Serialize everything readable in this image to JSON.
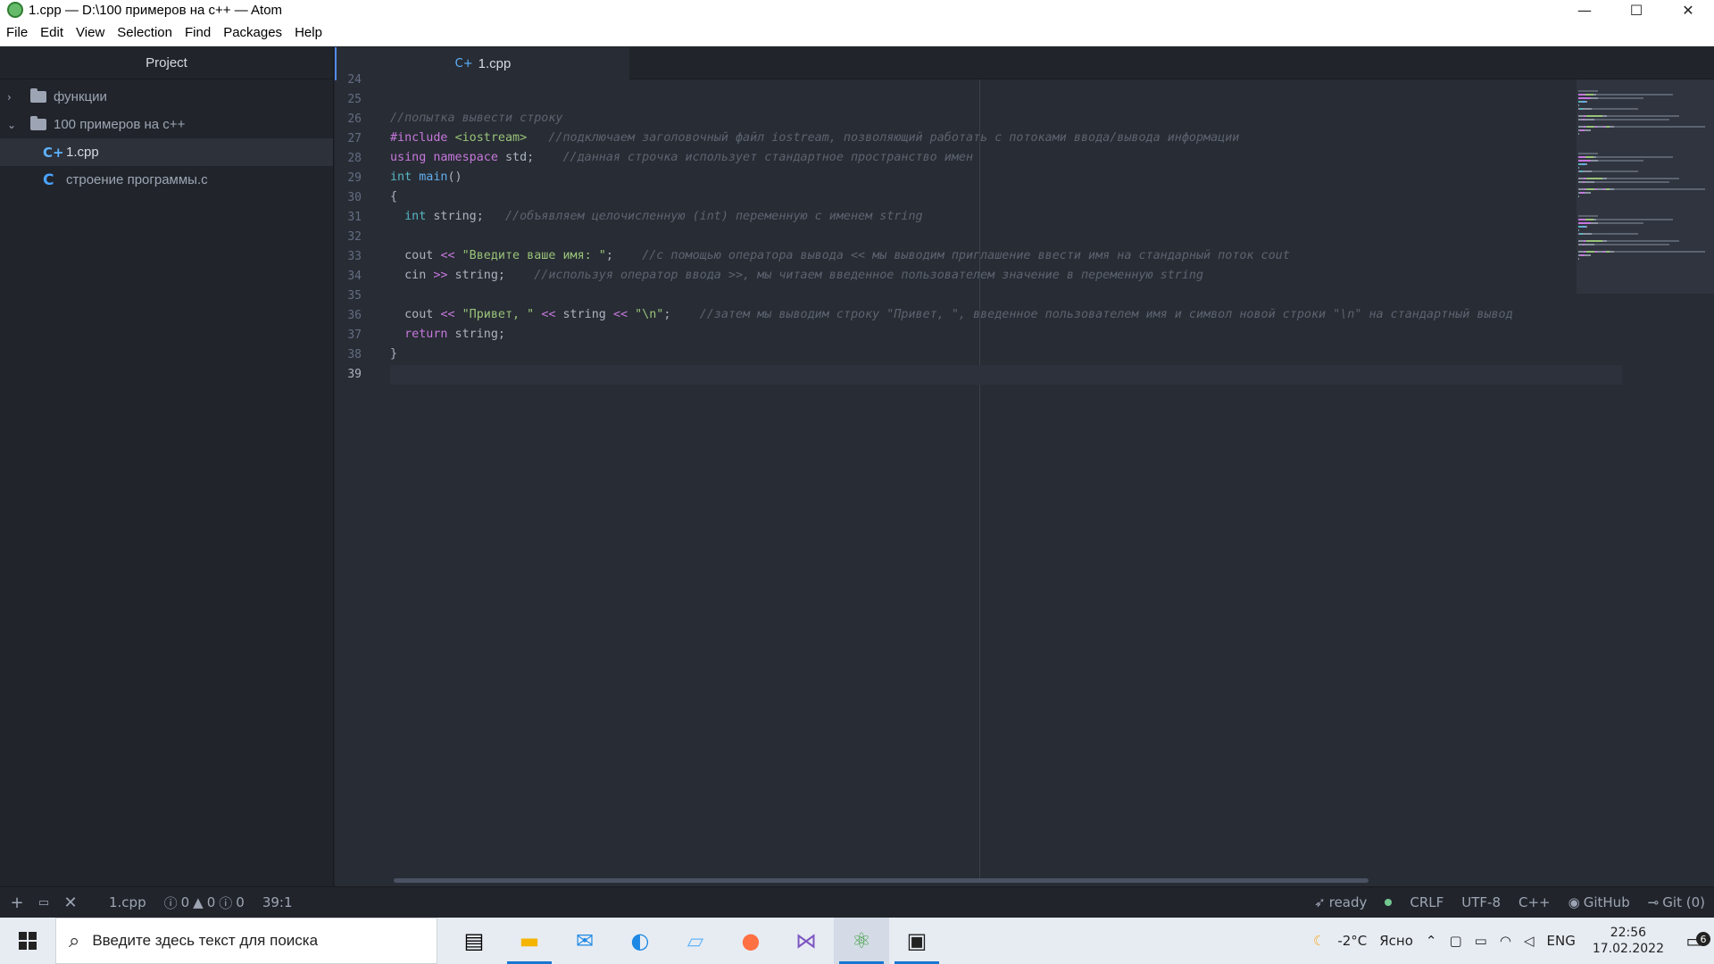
{
  "window": {
    "title": "1.cpp — D:\\100 примеров на c++ — Atom",
    "minimize_glyph": "—",
    "maximize_glyph": "☐",
    "close_glyph": "✕"
  },
  "menu": [
    "File",
    "Edit",
    "View",
    "Selection",
    "Find",
    "Packages",
    "Help"
  ],
  "sidebar": {
    "header": "Project",
    "items": [
      {
        "label": "функции",
        "type": "folder",
        "expanded": false
      },
      {
        "label": "100 примеров на c++",
        "type": "folder",
        "expanded": true
      },
      {
        "label": "1.cpp",
        "type": "file-cpp",
        "selected": true
      },
      {
        "label": "строение программы.c",
        "type": "file-c"
      }
    ]
  },
  "tab": {
    "label": "1.cpp"
  },
  "editor": {
    "line_numbers": [
      "24",
      "25",
      "26",
      "27",
      "28",
      "29",
      "30",
      "31",
      "32",
      "33",
      "34",
      "35",
      "36",
      "37",
      "38",
      "39"
    ],
    "current_line": "39",
    "lines": [
      {
        "no": "24",
        "tokens": []
      },
      {
        "no": "25",
        "tokens": []
      },
      {
        "no": "26",
        "tokens": [
          {
            "c": "cm",
            "t": "//попытка вывести строку"
          }
        ]
      },
      {
        "no": "27",
        "tokens": [
          {
            "c": "pp",
            "t": "#include "
          },
          {
            "c": "inc",
            "t": "<iostream>"
          },
          {
            "c": "",
            "t": "   "
          },
          {
            "c": "cm",
            "t": "//подключаем заголовочный файл iostream, позволяющий работать с потоками ввода/вывода информации"
          }
        ]
      },
      {
        "no": "28",
        "tokens": [
          {
            "c": "kw",
            "t": "using namespace"
          },
          {
            "c": "",
            "t": " std;    "
          },
          {
            "c": "cm",
            "t": "//данная строчка использует стандартное пространство имен"
          }
        ]
      },
      {
        "no": "29",
        "tokens": [
          {
            "c": "ty",
            "t": "int"
          },
          {
            "c": "",
            "t": " "
          },
          {
            "c": "fn",
            "t": "main"
          },
          {
            "c": "",
            "t": "()"
          }
        ]
      },
      {
        "no": "30",
        "tokens": [
          {
            "c": "",
            "t": "{"
          }
        ]
      },
      {
        "no": "31",
        "tokens": [
          {
            "c": "",
            "t": "  "
          },
          {
            "c": "ty",
            "t": "int"
          },
          {
            "c": "",
            "t": " string;   "
          },
          {
            "c": "cm",
            "t": "//объявляем целочисленную (int) переменную с именем string"
          }
        ]
      },
      {
        "no": "32",
        "tokens": []
      },
      {
        "no": "33",
        "tokens": [
          {
            "c": "",
            "t": "  cout "
          },
          {
            "c": "op",
            "t": "<<"
          },
          {
            "c": "",
            "t": " "
          },
          {
            "c": "str",
            "t": "\"Введите ваше имя: \""
          },
          {
            "c": "",
            "t": ";    "
          },
          {
            "c": "cm",
            "t": "//с помощью оператора вывода << мы выводим приглашение ввести имя на стандарный поток cout"
          }
        ]
      },
      {
        "no": "34",
        "tokens": [
          {
            "c": "",
            "t": "  cin "
          },
          {
            "c": "op",
            "t": ">>"
          },
          {
            "c": "",
            "t": " string;    "
          },
          {
            "c": "cm",
            "t": "//используя оператор ввода >>, мы читаем введенное пользователем значение в переменную string"
          }
        ]
      },
      {
        "no": "35",
        "tokens": []
      },
      {
        "no": "36",
        "tokens": [
          {
            "c": "",
            "t": "  cout "
          },
          {
            "c": "op",
            "t": "<<"
          },
          {
            "c": "",
            "t": " "
          },
          {
            "c": "str",
            "t": "\"Привет, \""
          },
          {
            "c": "",
            "t": " "
          },
          {
            "c": "op",
            "t": "<<"
          },
          {
            "c": "",
            "t": " string "
          },
          {
            "c": "op",
            "t": "<<"
          },
          {
            "c": "",
            "t": " "
          },
          {
            "c": "str",
            "t": "\"\\n\""
          },
          {
            "c": "",
            "t": ";    "
          },
          {
            "c": "cm",
            "t": "//затем мы выводим строку \"Привет, \", введенное пользователем имя и символ новой строки \"\\n\" на стандартный вывод"
          }
        ]
      },
      {
        "no": "37",
        "tokens": [
          {
            "c": "",
            "t": "  "
          },
          {
            "c": "kw",
            "t": "return"
          },
          {
            "c": "",
            "t": " string;"
          }
        ]
      },
      {
        "no": "38",
        "tokens": [
          {
            "c": "",
            "t": "}"
          }
        ]
      },
      {
        "no": "39",
        "tokens": []
      }
    ]
  },
  "statusbar": {
    "file": "1.cpp",
    "errors": "0",
    "warnings": "0",
    "infos": "0",
    "cursor": "39:1",
    "status": "ready",
    "line_ending": "CRLF",
    "encoding": "UTF-8",
    "grammar": "C++",
    "github": "GitHub",
    "git": "Git (0)"
  },
  "taskbar": {
    "search_placeholder": "Введите здесь текст для поиска",
    "apps": [
      "task-view",
      "file-explorer",
      "mail",
      "edge",
      "notepad",
      "firefox",
      "visual-studio",
      "atom",
      "terminal"
    ],
    "weather": "-2°C",
    "weather_text": "Ясно",
    "lang": "ENG",
    "time": "22:56",
    "date": "17.02.2022",
    "notifications": "6"
  },
  "colors": {
    "accent": "#568af2",
    "bg": "#282c34",
    "sidebar": "#21252b"
  }
}
